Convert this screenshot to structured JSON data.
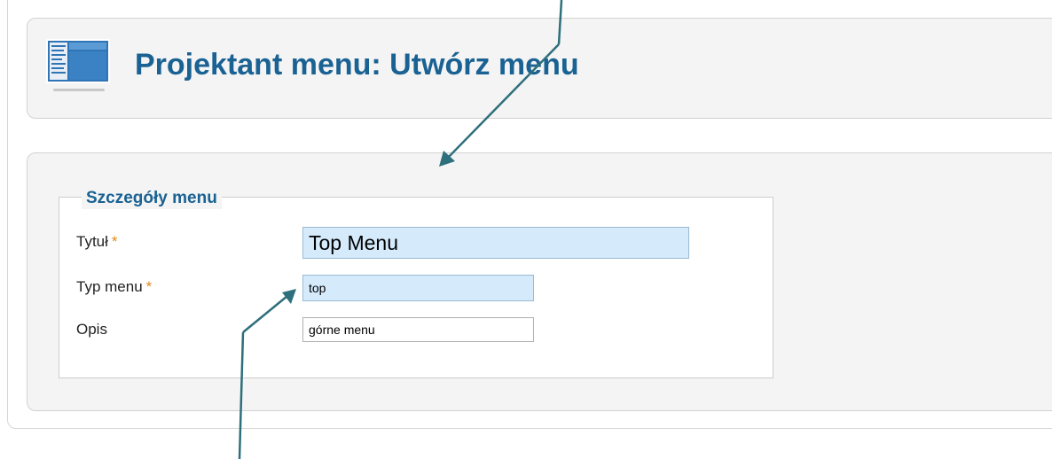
{
  "header": {
    "title": "Projektant menu: Utwórz menu",
    "icon": "menu-manager-icon"
  },
  "form": {
    "legend": "Szczegóły menu",
    "required_marker": "*",
    "fields": [
      {
        "label": "Tytuł",
        "value": "Top Menu",
        "required": true
      },
      {
        "label": "Typ menu",
        "value": "top",
        "required": true
      },
      {
        "label": "Opis",
        "value": "górne menu",
        "required": false
      }
    ]
  },
  "colors": {
    "title": "#1a6293",
    "required": "#e08a17",
    "input_highlight": "#d5ebfc",
    "panel_bg": "#f4f4f4",
    "annotation_arrow": "#2e6f7c"
  }
}
